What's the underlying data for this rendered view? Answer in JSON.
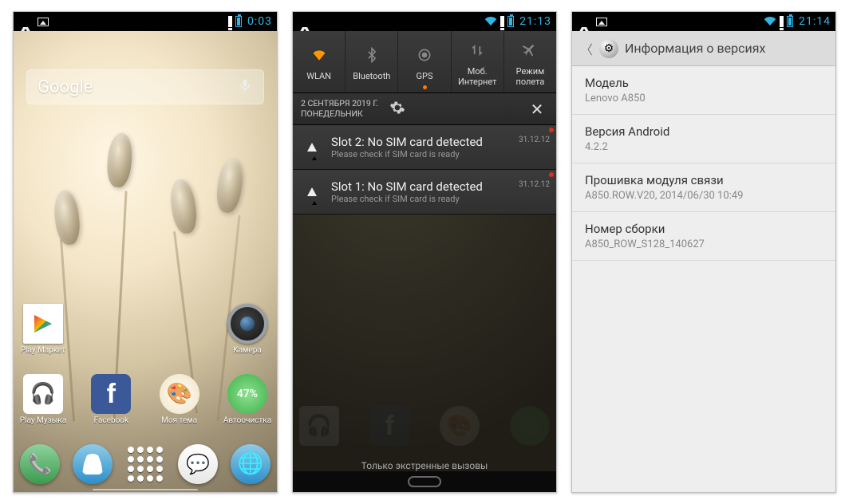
{
  "screen1": {
    "status": {
      "time": "0:03"
    },
    "search": {
      "placeholder": "Google"
    },
    "row_top": [
      {
        "name": "play-market",
        "label": "Play Маркет",
        "icon": "ic-play"
      },
      {
        "name": "camera",
        "label": "Камера",
        "icon": "ic-camera"
      }
    ],
    "row_mid": [
      {
        "name": "play-music",
        "label": "Play Музыка",
        "icon": "ic-music"
      },
      {
        "name": "facebook",
        "label": "Facebook",
        "icon": "ic-fb"
      },
      {
        "name": "my-theme",
        "label": "Моя тема",
        "icon": "ic-theme"
      },
      {
        "name": "autoclean",
        "label": "Автоочистка",
        "icon": "ic-clean",
        "badge": "47%"
      }
    ]
  },
  "screen2": {
    "status": {
      "time": "21:13"
    },
    "toggles": [
      {
        "name": "wlan",
        "label": "WLAN",
        "active": true
      },
      {
        "name": "bluetooth",
        "label": "Bluetooth",
        "active": false
      },
      {
        "name": "gps",
        "label": "GPS",
        "active": false,
        "dot": true
      },
      {
        "name": "mobile-internet",
        "label": "Моб.\nИнтернет",
        "active": false
      },
      {
        "name": "flight-mode",
        "label": "Режим\nполета",
        "active": false
      }
    ],
    "date_line1": "2 СЕНТЯБРЯ 2019 Г.",
    "date_line2": "ПОНЕДЕЛЬНИК",
    "notifications": [
      {
        "title": "Slot 2: No SIM card detected",
        "sub": "Please check if SIM card is ready",
        "ts": "31.12.12"
      },
      {
        "title": "Slot 1: No SIM card detected",
        "sub": "Please check if SIM card is ready",
        "ts": "31.12.12"
      }
    ],
    "emergency": "Только экстренные вызовы"
  },
  "screen3": {
    "status": {
      "time": "21:14"
    },
    "header": "Информация о версиях",
    "rows": [
      {
        "k": "Модель",
        "v": "Lenovo A850"
      },
      {
        "k": "Версия Android",
        "v": "4.2.2"
      },
      {
        "k": "Прошивка модуля связи",
        "v": "A850.ROW.V20, 2014/06/30 10:49"
      },
      {
        "k": "Номер сборки",
        "v": "A850_ROW_S128_140627"
      }
    ]
  }
}
